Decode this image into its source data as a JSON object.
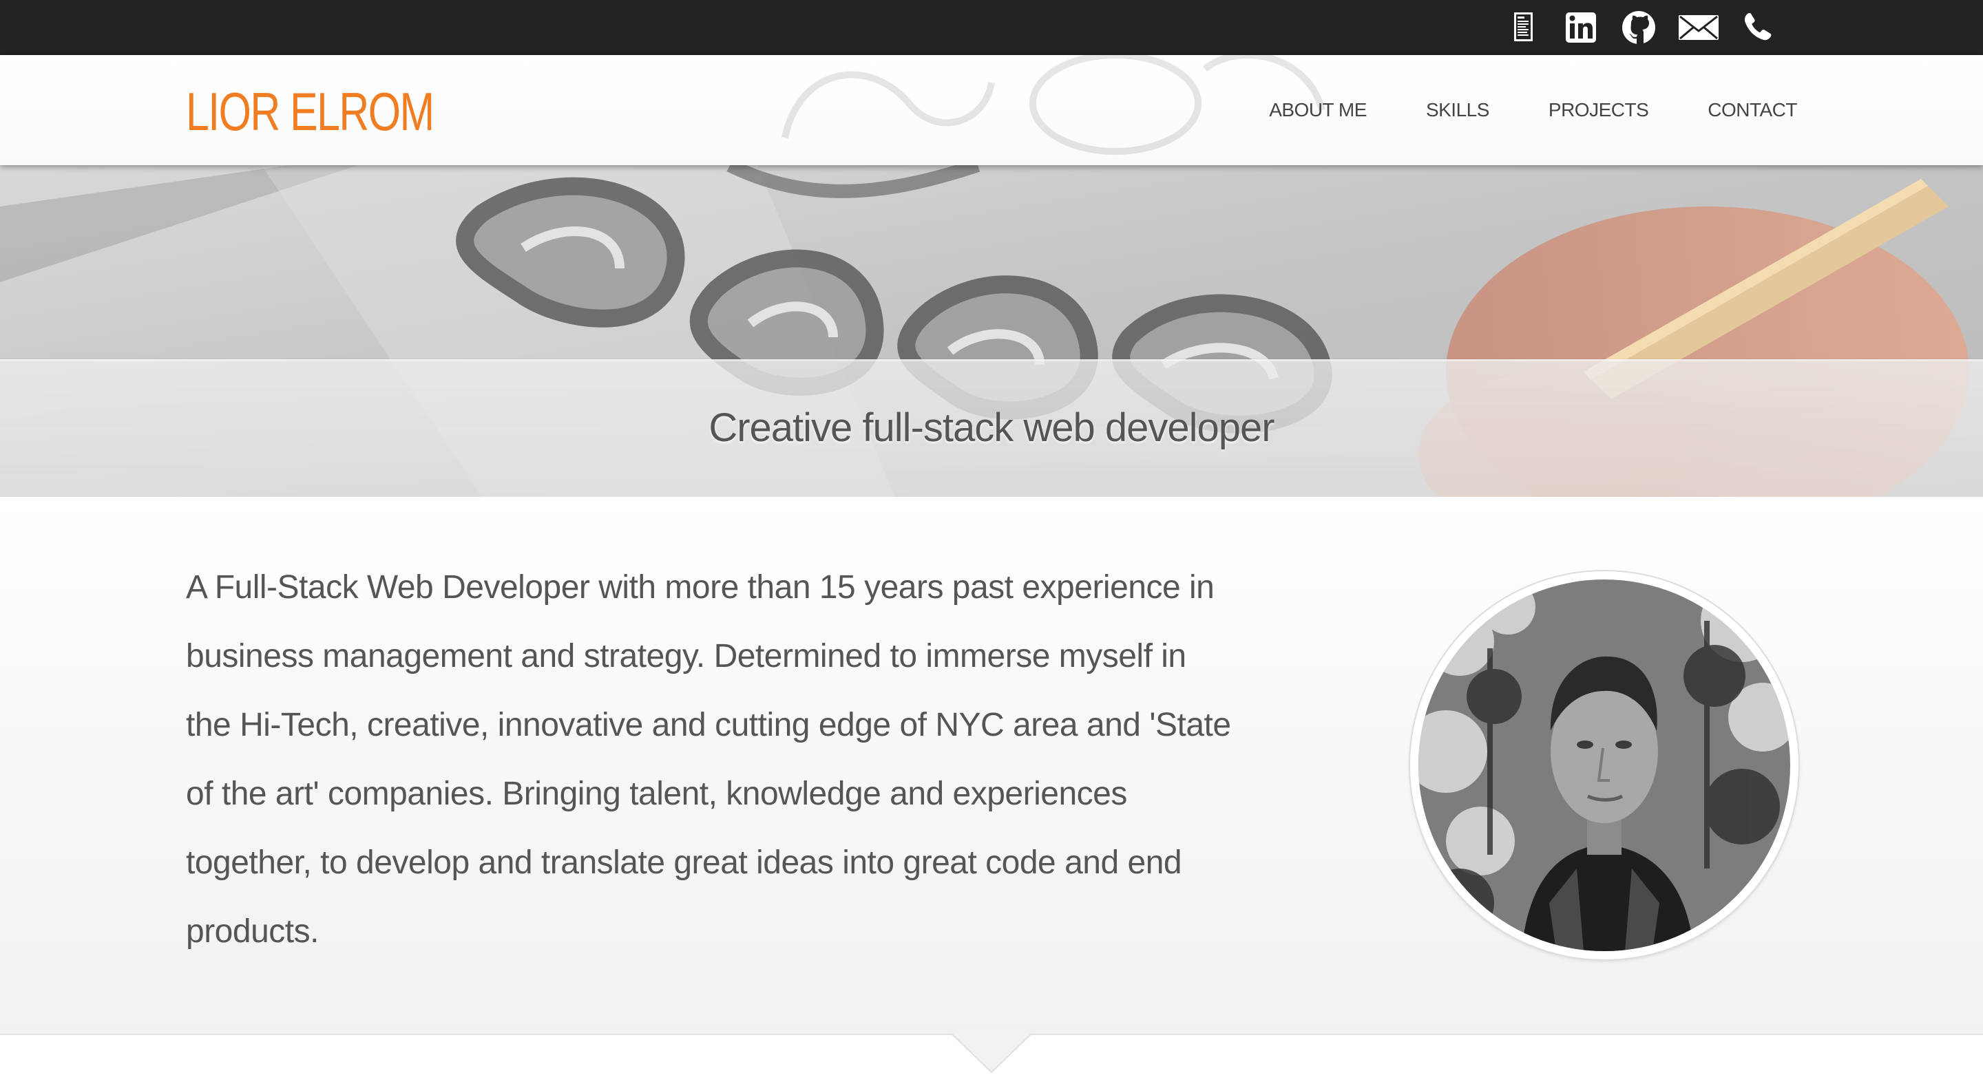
{
  "topbar": {
    "icons": [
      "resume-icon",
      "linkedin-icon",
      "github-icon",
      "mail-icon",
      "phone-icon"
    ]
  },
  "header": {
    "logo": "LIOR ELROM",
    "nav": [
      "ABOUT ME",
      "SKILLS",
      "PROJECTS",
      "CONTACT"
    ]
  },
  "hero": {
    "tagline": "Creative full-stack web developer"
  },
  "about": {
    "bio": "A Full-Stack Web Developer with more than 15 years past experience in business management and strategy. Determined to immerse myself in the Hi-Tech, creative, innovative and cutting edge of NYC area and 'State of the art' companies. Bringing talent, knowledge and experiences together, to develop and translate great ideas into great code and end products."
  },
  "colors": {
    "accent": "#f07d22",
    "topbar": "#222222",
    "text": "#555555",
    "nav": "#444444"
  }
}
